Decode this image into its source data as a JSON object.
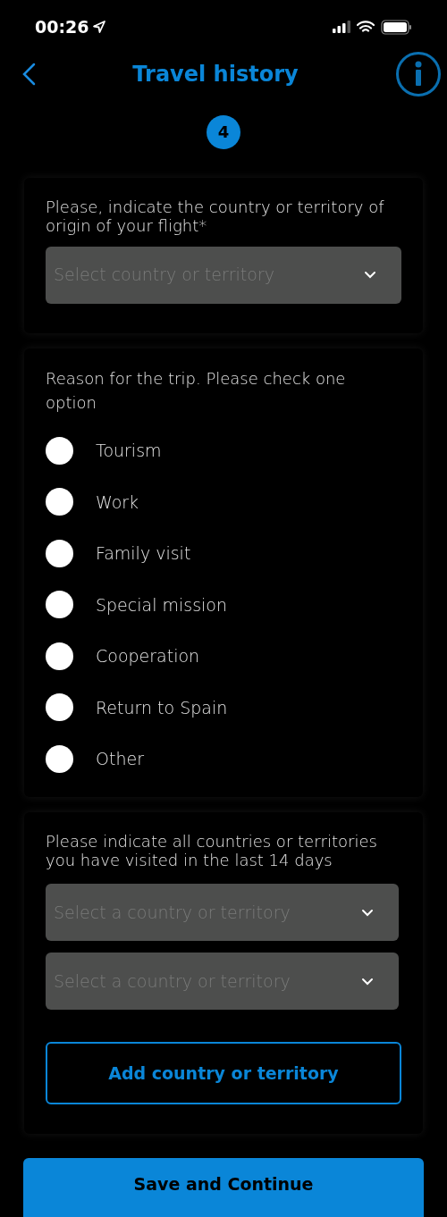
{
  "status_bar": {
    "time": "00:26"
  },
  "header": {
    "title": "Travel history"
  },
  "step": {
    "number": "4"
  },
  "origin": {
    "label": "Please, indicate the country or territory of origin of your flight*",
    "select": {
      "placeholder": "Select country or territory"
    }
  },
  "reason": {
    "label": "Reason for the trip. Please check one option",
    "options": [
      {
        "label": "Tourism",
        "selected": false
      },
      {
        "label": "Work",
        "selected": false
      },
      {
        "label": "Family visit",
        "selected": false
      },
      {
        "label": "Special mission",
        "selected": false
      },
      {
        "label": "Cooperation",
        "selected": false
      },
      {
        "label": "Return to Spain",
        "selected": false
      },
      {
        "label": "Other",
        "selected": false
      }
    ]
  },
  "visited": {
    "label": "Please indicate all countries or territories you have visited in the last 14 days",
    "selects": [
      {
        "placeholder": "Select a country or territory"
      },
      {
        "placeholder": "Select a country or territory"
      }
    ],
    "add_button": "Add country or territory"
  },
  "save_button": "Save and Continue"
}
